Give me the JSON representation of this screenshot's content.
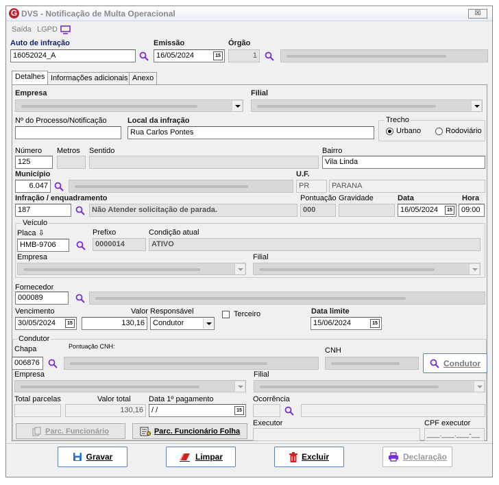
{
  "window": {
    "title": "DVS - Notificação de Multa Operacional",
    "close_symbol": "☒"
  },
  "menu": {
    "saida": "Saída",
    "lgpd": "LGPD"
  },
  "header": {
    "auto_label": "Auto de infração",
    "auto_value": "16052024_A",
    "emissao_label": "Emissão",
    "emissao_value": "16/05/2024",
    "orgao_label": "Órgão",
    "orgao_value": "1"
  },
  "tabs": [
    {
      "label": "Detalhes"
    },
    {
      "label": "Informações adicionais"
    },
    {
      "label": "Anexo"
    }
  ],
  "detalhes": {
    "empresa_label": "Empresa",
    "filial_label": "Filial",
    "processo_label": "Nº do Processo/Notificação",
    "processo_value": "",
    "local_label": "Local da infração",
    "local_value": "Rua Carlos Pontes",
    "trecho_label": "Trecho",
    "urbano_label": "Urbano",
    "rodoviario_label": "Rodoviário",
    "numero_label": "Número",
    "numero_value": "125",
    "metros_label": "Metros",
    "sentido_label": "Sentido",
    "bairro_label": "Bairro",
    "bairro_value": "Vila Linda",
    "municipio_label": "Município",
    "municipio_value": "6.047",
    "uf_label": "U.F.",
    "uf_value": "PR",
    "estado_value": "PARANA",
    "infracao_label": "Infração / enquadramento",
    "infracao_code": "187",
    "infracao_desc": "Não Atender solicitação de parada.",
    "pontuacao_label": "Pontuação",
    "pontuacao_value": "000",
    "gravidade_label": "Gravidade",
    "data_label": "Data",
    "data_value": "16/05/2024",
    "hora_label": "Hora",
    "hora_value": "09:00"
  },
  "veiculo": {
    "group_label": "Veículo",
    "placa_label": "Placa ⇩",
    "placa_value": "HMB-9706",
    "prefixo_label": "Prefixo",
    "prefixo_value": "0000014",
    "condicao_label": "Condição atual",
    "condicao_value": "ATIVO",
    "empresa_label": "Empresa",
    "filial_label": "Filial"
  },
  "fornecedor": {
    "label": "Fornecedor",
    "value": "000089",
    "vencimento_label": "Vencimento",
    "vencimento_value": "30/05/2024",
    "valor_label": "Valor",
    "valor_value": "130,16",
    "responsavel_label": "Responsável",
    "responsavel_value": "Condutor",
    "terceiro_label": "Terceiro",
    "data_limite_label": "Data limite",
    "data_limite_value": "15/06/2024"
  },
  "condutor": {
    "group_label": "Condutor",
    "chapa_label": "Chapa",
    "chapa_value": "006876",
    "pontuacao_cnh_label": "Pontuação CNH:",
    "cnh_label": "CNH",
    "condutor_button": "Condutor",
    "empresa_label": "Empresa",
    "filial_label": "Filial",
    "total_parcelas_label": "Total parcelas",
    "total_parcelas_value": "",
    "valor_total_label": "Valor total",
    "valor_total_value": "130,16",
    "data_pagamento_label": "Data 1º pagamento",
    "data_pagamento_value": " / /",
    "ocorrencia_label": "Ocorrência",
    "parc_func_button": "Parc. Funcionário",
    "parc_func_folha_button": "Parc. Funcionário Folha",
    "executor_label": "Executor",
    "cpf_executor_label": "CPF executor",
    "cpf_executor_value": "___.___.___-__"
  },
  "footer": {
    "gravar": "Gravar",
    "limpar": "Limpar",
    "excluir": "Excluir",
    "declaracao": "Declaração"
  },
  "colors": {
    "accent": "#7a2bd6",
    "label_blue": "#0d1f6b",
    "excluir_red": "#d42020",
    "gravar_blue": "#2a6fd6",
    "logo_red": "#c0202a"
  }
}
